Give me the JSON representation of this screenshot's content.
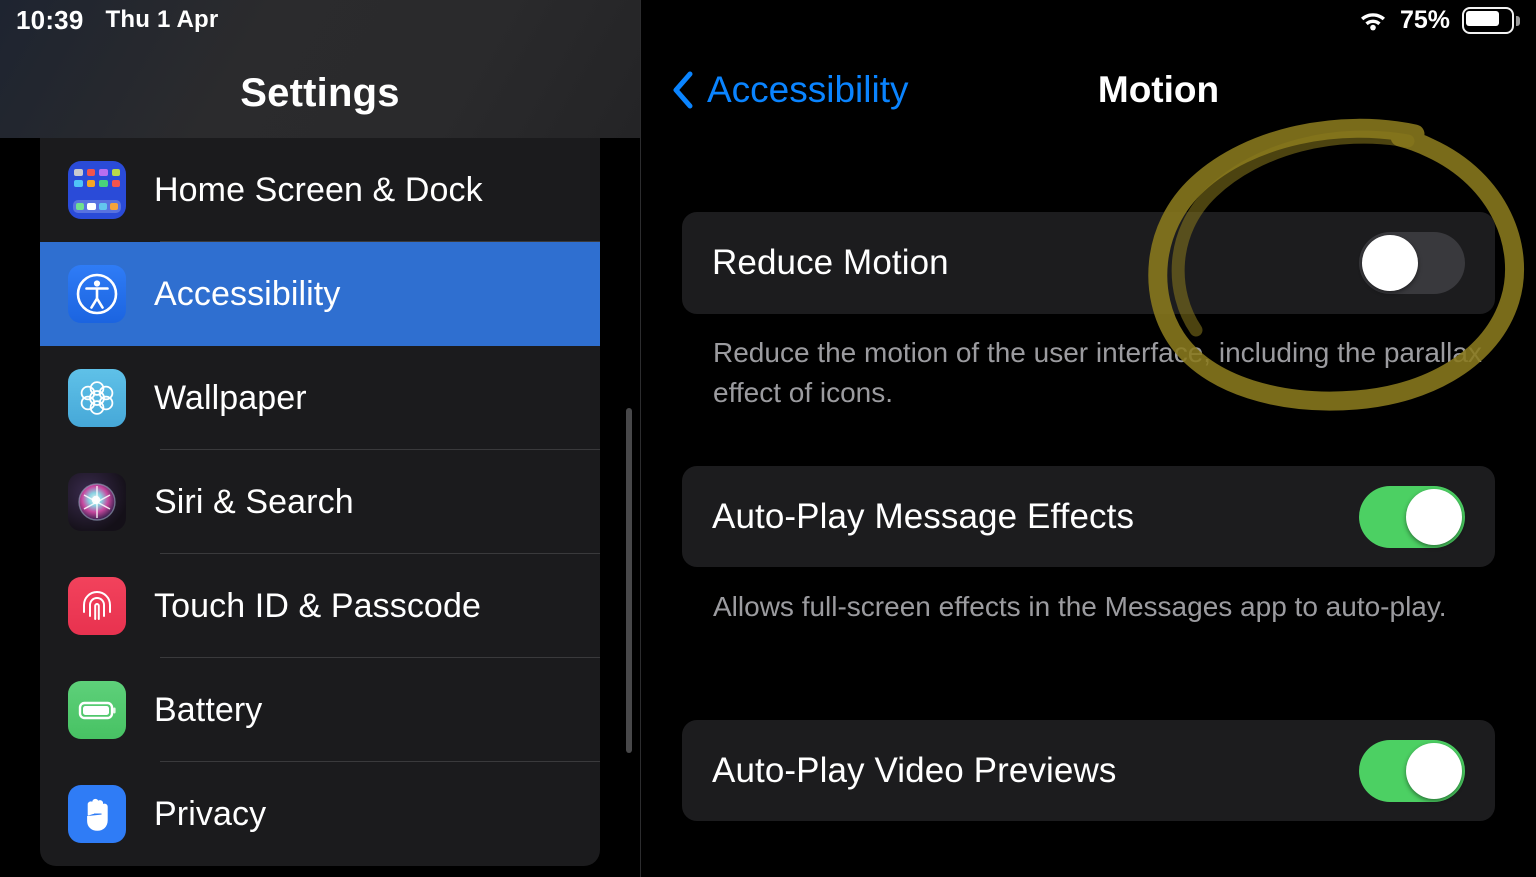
{
  "status_bar": {
    "time": "10:39",
    "date": "Thu 1 Apr",
    "battery_percent": "75%",
    "wifi_icon": "wifi-icon",
    "battery_icon": "battery-icon"
  },
  "sidebar": {
    "title": "Settings",
    "items": [
      {
        "label": "Home Screen & Dock",
        "icon": "home-screen-dock-icon",
        "selected": false
      },
      {
        "label": "Accessibility",
        "icon": "accessibility-icon",
        "selected": true
      },
      {
        "label": "Wallpaper",
        "icon": "wallpaper-icon",
        "selected": false
      },
      {
        "label": "Siri & Search",
        "icon": "siri-icon",
        "selected": false
      },
      {
        "label": "Touch ID & Passcode",
        "icon": "fingerprint-icon",
        "selected": false
      },
      {
        "label": "Battery",
        "icon": "battery-icon",
        "selected": false
      },
      {
        "label": "Privacy",
        "icon": "hand-icon",
        "selected": false
      }
    ],
    "selected_color": "#2f6fd0"
  },
  "detail": {
    "back_label": "Accessibility",
    "back_icon": "chevron-left-icon",
    "title": "Motion",
    "rows": [
      {
        "label": "Reduce Motion",
        "toggle_state": "off",
        "footnote": "Reduce the motion of the user interface, including the parallax effect of icons."
      },
      {
        "label": "Auto-Play Message Effects",
        "toggle_state": "on",
        "footnote": "Allows full-screen effects in the Messages app to auto-play."
      },
      {
        "label": "Auto-Play Video Previews",
        "toggle_state": "on",
        "footnote": ""
      }
    ],
    "accent_color": "#0a84ff",
    "toggle_on_color": "#4cd063",
    "toggle_off_color": "#39393d"
  },
  "annotation": {
    "shape": "hand-drawn-circle",
    "target": "Reduce Motion toggle",
    "color": "#8a7a1e"
  }
}
